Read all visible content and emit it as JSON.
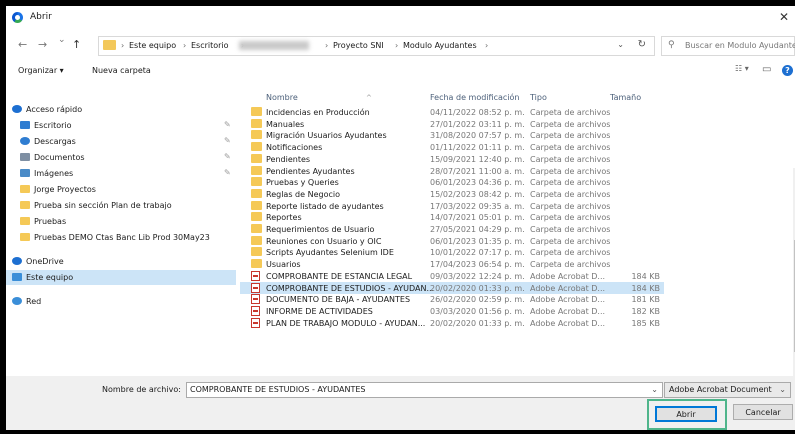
{
  "window": {
    "title": "Abrir",
    "close_glyph": "✕"
  },
  "nav": {
    "back_glyph": "←",
    "forward_glyph": "→",
    "recent_glyph": "⌄",
    "up_glyph": "↑",
    "breadcrumbs": [
      "Este equipo",
      "Escritorio",
      "Proyecto SNI",
      "Modulo Ayudantes"
    ],
    "separator": "›",
    "search_placeholder": "Buscar en Modulo Ayudantes"
  },
  "toolbar": {
    "organize": "Organizar ▾",
    "new_folder": "Nueva carpeta",
    "view_glyph": "☷ ▾",
    "pane_glyph": "▭",
    "help_glyph": "?"
  },
  "sidebar": {
    "items": [
      {
        "label": "Acceso rápido",
        "icon": "star-icon"
      },
      {
        "label": "Escritorio",
        "icon": "desktop-icon",
        "pinned": true
      },
      {
        "label": "Descargas",
        "icon": "download-icon",
        "pinned": true
      },
      {
        "label": "Documentos",
        "icon": "documents-icon",
        "pinned": true
      },
      {
        "label": "Imágenes",
        "icon": "images-icon",
        "pinned": true
      },
      {
        "label": "Jorge Proyectos",
        "icon": "folder-icon"
      },
      {
        "label": "Prueba sin sección Plan de trabajo",
        "icon": "folder-icon"
      },
      {
        "label": "Pruebas",
        "icon": "folder-icon"
      },
      {
        "label": "Pruebas DEMO Ctas Banc Lib Prod 30May23",
        "icon": "folder-icon"
      },
      {
        "label": "OneDrive",
        "icon": "cloud-icon"
      },
      {
        "label": "Este equipo",
        "icon": "computer-icon",
        "selected": true
      },
      {
        "label": "Red",
        "icon": "network-icon"
      }
    ]
  },
  "columns": {
    "name": "Nombre",
    "date": "Fecha de modificación",
    "type": "Tipo",
    "size": "Tamaño"
  },
  "files": [
    {
      "name": "Incidencias en Producción",
      "date": "04/11/2022 08:52 p. m.",
      "type": "Carpeta de archivos",
      "size": "",
      "kind": "folder"
    },
    {
      "name": "Manuales",
      "date": "27/01/2022 03:11 p. m.",
      "type": "Carpeta de archivos",
      "size": "",
      "kind": "folder"
    },
    {
      "name": "Migración Usuarios Ayudantes",
      "date": "31/08/2020 07:57 p. m.",
      "type": "Carpeta de archivos",
      "size": "",
      "kind": "folder"
    },
    {
      "name": "Notificaciones",
      "date": "01/11/2022 01:11 p. m.",
      "type": "Carpeta de archivos",
      "size": "",
      "kind": "folder"
    },
    {
      "name": "Pendientes",
      "date": "15/09/2021 12:40 p. m.",
      "type": "Carpeta de archivos",
      "size": "",
      "kind": "folder"
    },
    {
      "name": "Pendientes Ayudantes",
      "date": "28/07/2021 11:00 a. m.",
      "type": "Carpeta de archivos",
      "size": "",
      "kind": "folder"
    },
    {
      "name": "Pruebas y Queries",
      "date": "06/01/2023 04:36 p. m.",
      "type": "Carpeta de archivos",
      "size": "",
      "kind": "folder"
    },
    {
      "name": "Reglas de Negocio",
      "date": "15/02/2023 08:42 p. m.",
      "type": "Carpeta de archivos",
      "size": "",
      "kind": "folder"
    },
    {
      "name": "Reporte listado de ayudantes",
      "date": "17/03/2022 09:35 a. m.",
      "type": "Carpeta de archivos",
      "size": "",
      "kind": "folder"
    },
    {
      "name": "Reportes",
      "date": "14/07/2021 05:01 p. m.",
      "type": "Carpeta de archivos",
      "size": "",
      "kind": "folder"
    },
    {
      "name": "Requerimientos de Usuario",
      "date": "27/05/2021 04:29 p. m.",
      "type": "Carpeta de archivos",
      "size": "",
      "kind": "folder"
    },
    {
      "name": "Reuniones con Usuario y OIC",
      "date": "06/01/2023 01:35 p. m.",
      "type": "Carpeta de archivos",
      "size": "",
      "kind": "folder"
    },
    {
      "name": "Scripts Ayudantes Selenium IDE",
      "date": "10/01/2022 07:17 p. m.",
      "type": "Carpeta de archivos",
      "size": "",
      "kind": "folder"
    },
    {
      "name": "Usuarios",
      "date": "17/04/2023 06:54 p. m.",
      "type": "Carpeta de archivos",
      "size": "",
      "kind": "folder"
    },
    {
      "name": "COMPROBANTE DE ESTANCIA LEGAL",
      "date": "09/03/2022 12:24 p. m.",
      "type": "Adobe Acrobat D...",
      "size": "184 KB",
      "kind": "pdf"
    },
    {
      "name": "COMPROBANTE DE ESTUDIOS - AYUDAN...",
      "date": "20/02/2020 01:33 p. m.",
      "type": "Adobe Acrobat D...",
      "size": "184 KB",
      "kind": "pdf",
      "selected": true
    },
    {
      "name": "DOCUMENTO DE BAJA - AYUDANTES",
      "date": "26/02/2020 02:59 p. m.",
      "type": "Adobe Acrobat D...",
      "size": "181 KB",
      "kind": "pdf"
    },
    {
      "name": "INFORME DE ACTIVIDADES",
      "date": "03/03/2020 01:56 p. m.",
      "type": "Adobe Acrobat D...",
      "size": "182 KB",
      "kind": "pdf"
    },
    {
      "name": "PLAN DE TRABAJO MODULO - AYUDAN...",
      "date": "20/02/2020 01:33 p. m.",
      "type": "Adobe Acrobat D...",
      "size": "185 KB",
      "kind": "pdf"
    }
  ],
  "bottom": {
    "filename_label": "Nombre de archivo:",
    "filename_value": "COMPROBANTE DE ESTUDIOS - AYUDANTES",
    "filter_value": "Adobe Acrobat Document",
    "dropdown_glyph": "⌄",
    "open_label": "Abrir",
    "cancel_label": "Cancelar"
  },
  "colors": {
    "selection": "#cce4f7",
    "accent": "#0078d7",
    "highlight_box": "#4fb58b",
    "folder": "#f5c957",
    "pdf": "#c8372d"
  }
}
